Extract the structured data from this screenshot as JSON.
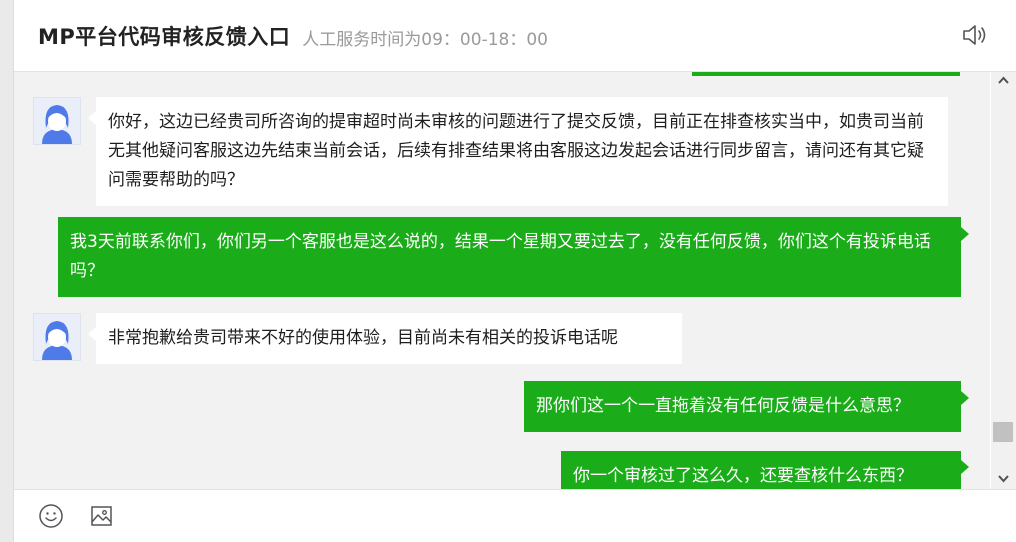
{
  "header": {
    "title": "MP平台代码审核反馈入口",
    "service_hours": "人工服务时间为09：00-18：00",
    "speaker_icon": "speaker-icon"
  },
  "messages": [
    {
      "sender": "agent",
      "text": "你好，这边已经贵司所咨询的提审超时尚未审核的问题进行了提交反馈，目前正在排查核实当中，如贵司当前无其他疑问客服这边先结束当前会话，后续有排查结果将由客服这边发起会话进行同步留言，请问还有其它疑问需要帮助的吗？"
    },
    {
      "sender": "user",
      "text": "我3天前联系你们，你们另一个客服也是这么说的，结果一个星期又要过去了，没有任何反馈，你们这个有投诉电话吗？"
    },
    {
      "sender": "agent",
      "text": "非常抱歉给贵司带来不好的使用体验，目前尚未有相关的投诉电话呢"
    },
    {
      "sender": "user",
      "text": "那你们这一个一直拖着没有任何反馈是什么意思？"
    },
    {
      "sender": "user",
      "text": "你一个审核过了这么久，还要查核什么东西？"
    }
  ],
  "toolbar": {
    "emoji_icon": "smiley-icon",
    "image_icon": "image-icon"
  },
  "colors": {
    "outgoing_bubble": "#1aad19",
    "incoming_bubble": "#ffffff",
    "chat_background": "#f2f2f2"
  }
}
